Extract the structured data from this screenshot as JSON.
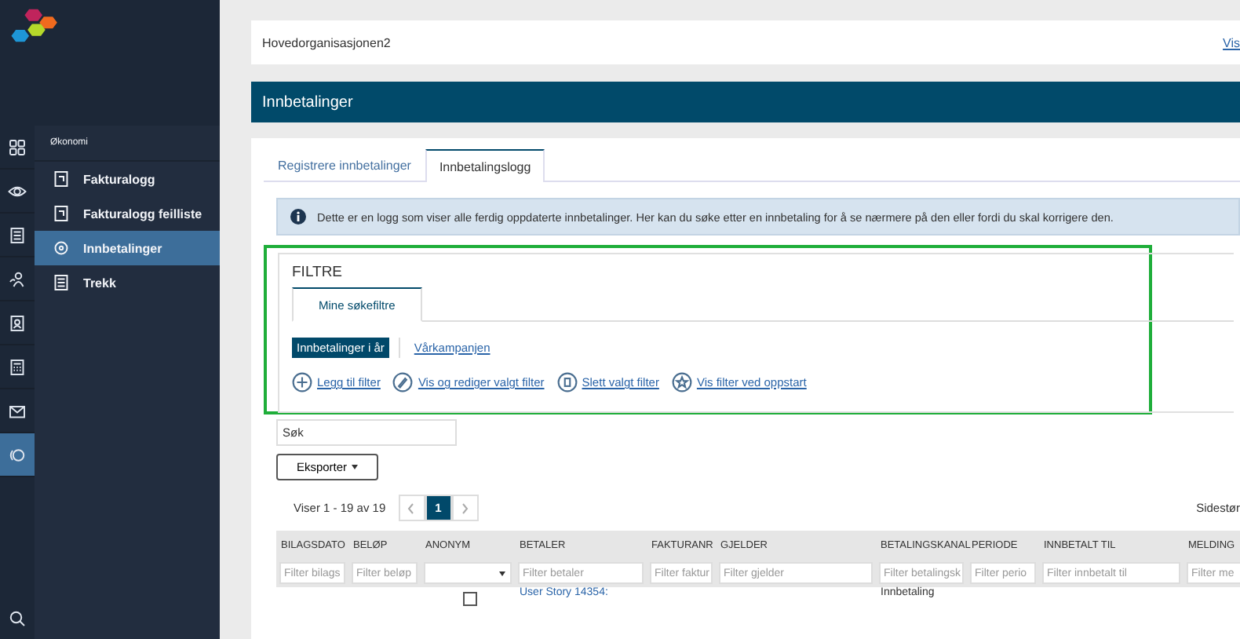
{
  "rail": [
    {
      "selected": false
    },
    {
      "selected": false
    },
    {
      "selected": false
    },
    {
      "selected": false
    },
    {
      "selected": false
    },
    {
      "selected": false
    },
    {
      "selected": false
    },
    {
      "selected": true
    }
  ],
  "subnav": {
    "heading": "Økonomi",
    "items": [
      {
        "label": "Fakturalogg",
        "selected": false
      },
      {
        "label": "Fakturalogg feilliste",
        "selected": false
      },
      {
        "label": "Innbetalinger",
        "selected": true
      },
      {
        "label": "Trekk",
        "selected": false
      }
    ]
  },
  "header": {
    "organization": "Hovedorganisasjonen2",
    "link": "Vis"
  },
  "page_title": "Innbetalinger",
  "tabs": [
    {
      "label": "Registrere innbetalinger",
      "selected": false
    },
    {
      "label": "Innbetalingslogg",
      "selected": true
    }
  ],
  "info": "Dette er en logg som viser alle ferdig oppdaterte innbetalinger. Her kan du søke etter en innbetaling for å se nærmere på den eller fordi du skal korrigere den.",
  "filters": {
    "title": "FILTRE",
    "highlighted": true,
    "tabs": [
      {
        "label": "Mine søkefiltre",
        "selected": true
      }
    ],
    "saved": [
      {
        "label": "Innbetalinger i år",
        "selected": true
      },
      {
        "label": "Vårkampanjen",
        "selected": false
      }
    ],
    "actions": [
      {
        "label": "Legg til filter"
      },
      {
        "label": "Vis og rediger valgt filter"
      },
      {
        "label": "Slett valgt filter"
      },
      {
        "label": "Vis filter ved oppstart"
      }
    ]
  },
  "search": {
    "placeholder": "Søk"
  },
  "export_button": "Eksporter",
  "paging": {
    "summary": "Viser 1 - 19 av 19",
    "pages": [
      {
        "label": "1",
        "selected": true
      }
    ],
    "page_size_label": "Sidestør"
  },
  "table": {
    "columns": [
      {
        "label": "BILAGSDATO",
        "filter": "Filter bilags",
        "kind": "text"
      },
      {
        "label": "BELØP",
        "filter": "Filter beløp",
        "kind": "text"
      },
      {
        "label": "ANONYM",
        "kind": "select"
      },
      {
        "label": "BETALER",
        "filter": "Filter betaler",
        "kind": "text"
      },
      {
        "label": "FAKTURANR",
        "filter": "Filter faktur",
        "kind": "text"
      },
      {
        "label": "GJELDER",
        "filter": "Filter gjelder",
        "kind": "text"
      },
      {
        "label": "BETALINGSKANAL",
        "filter": "Filter betalingsk",
        "kind": "text"
      },
      {
        "label": "PERIODE",
        "filter": "Filter perio",
        "kind": "text"
      },
      {
        "label": "INNBETALT TIL",
        "filter": "Filter innbetalt til",
        "kind": "text"
      },
      {
        "label": "MELDING",
        "filter": "Filter me",
        "kind": "text"
      }
    ],
    "rows": [
      {
        "payer": "User Story 14354:",
        "channel": "Innbetaling",
        "anonymous": false
      }
    ]
  }
}
